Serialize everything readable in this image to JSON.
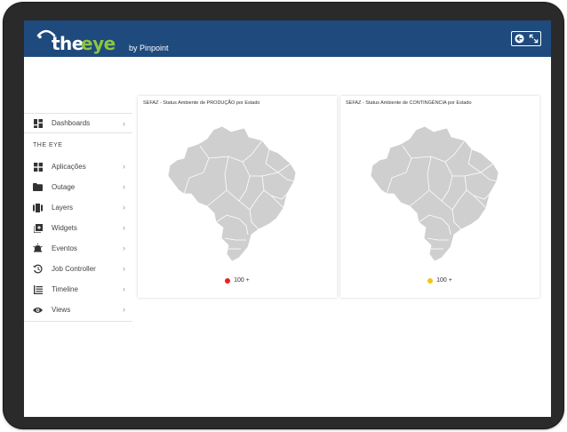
{
  "header": {
    "logo_the": "the",
    "logo_eye": "eye",
    "logo_by": "by Pinpoint",
    "actions": [
      {
        "icon": "back-arrow-icon"
      },
      {
        "icon": "fullscreen-icon"
      }
    ]
  },
  "sidebar": {
    "dashboards_label": "Dashboards",
    "section_title": "THE EYE",
    "items": [
      {
        "label": "Aplicações",
        "icon": "grid-icon"
      },
      {
        "label": "Outage",
        "icon": "folder-icon"
      },
      {
        "label": "Layers",
        "icon": "layers-icon"
      },
      {
        "label": "Widgets",
        "icon": "widgets-icon"
      },
      {
        "label": "Eventos",
        "icon": "alarm-icon"
      },
      {
        "label": "Job Controller",
        "icon": "history-icon"
      },
      {
        "label": "Timeline",
        "icon": "timeline-icon"
      },
      {
        "label": "Views",
        "icon": "eye-icon"
      }
    ],
    "chevron": "›"
  },
  "panels": [
    {
      "title": "SEFAZ - Status Ambiente de PRODUÇÃO por Estado",
      "legend_label": "100 +",
      "legend_color": "#e8211d",
      "map_color": "#cfcfcf"
    },
    {
      "title": "SEFAZ - Status Ambiente de CONTINGÊNCIA por Estado",
      "legend_label": "100 +",
      "legend_color": "#f0c419",
      "map_color": "#cfcfcf"
    }
  ],
  "colors": {
    "header_bg": "#1e4a7d",
    "brand_green": "#8cc63f"
  }
}
